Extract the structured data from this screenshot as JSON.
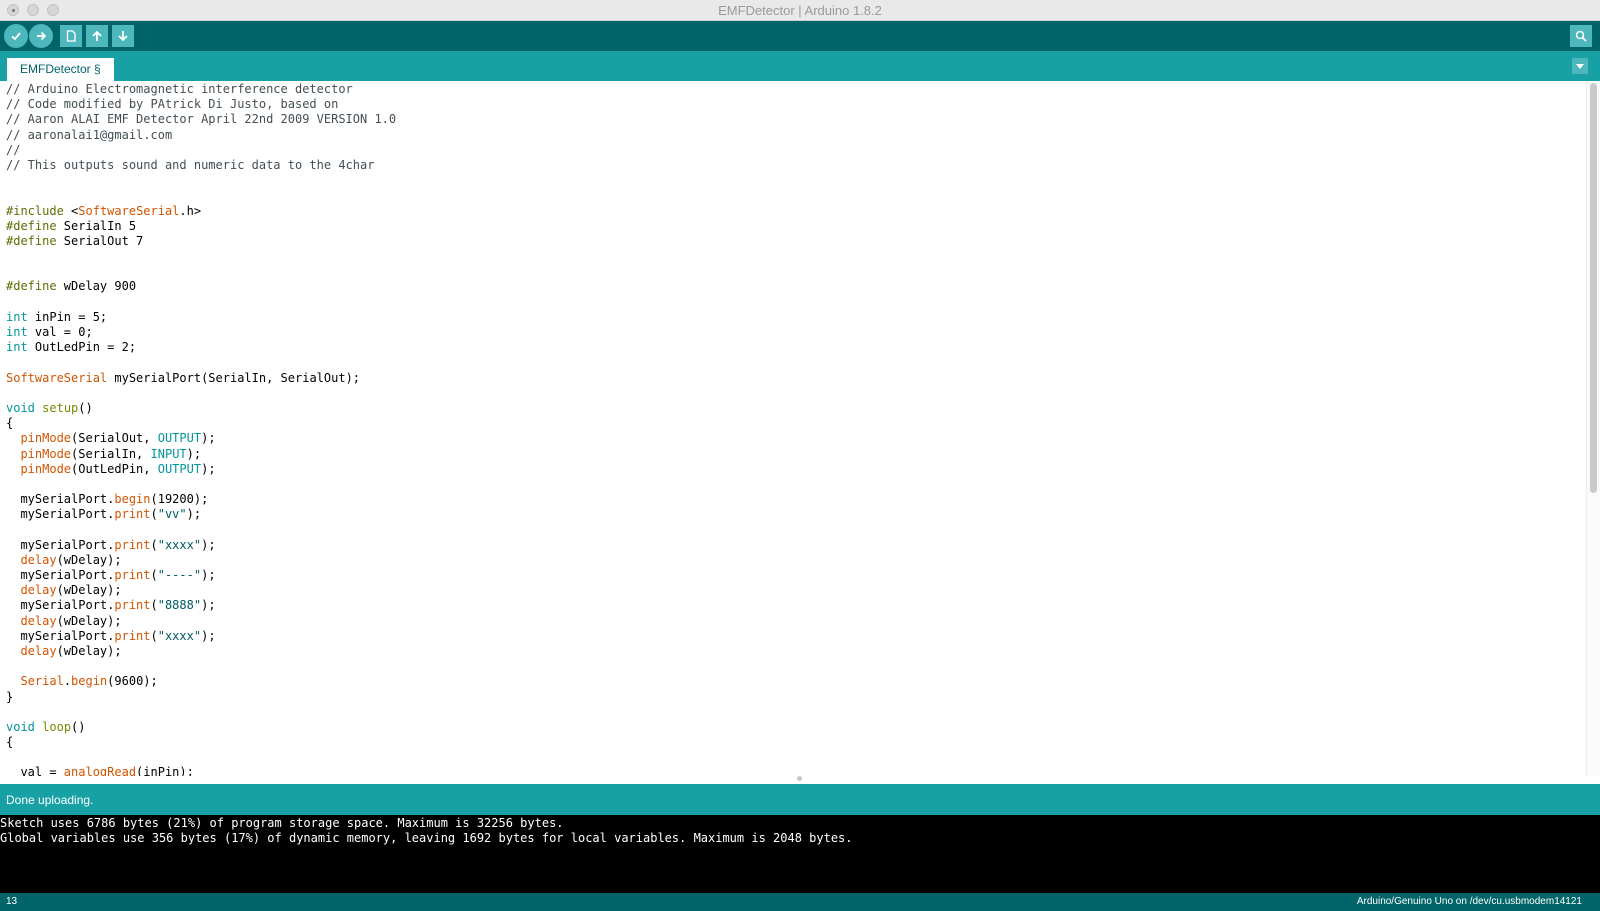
{
  "window": {
    "title": "EMFDetector | Arduino 1.8.2"
  },
  "toolbar": {
    "buttons": [
      {
        "name": "verify",
        "icon": "check-icon"
      },
      {
        "name": "upload",
        "icon": "arrow-right-icon"
      },
      {
        "name": "new",
        "icon": "document-icon"
      },
      {
        "name": "open",
        "icon": "arrow-up-icon"
      },
      {
        "name": "save",
        "icon": "arrow-down-icon"
      },
      {
        "name": "serial-monitor",
        "icon": "magnifier-icon"
      }
    ]
  },
  "tabs": [
    {
      "label": "EMFDetector §",
      "active": true
    }
  ],
  "editor": {
    "lines": [
      [
        [
          "c",
          "// Arduino Electromagnetic interference detector"
        ]
      ],
      [
        [
          "c",
          "// Code modified by PAtrick Di Justo, based on"
        ]
      ],
      [
        [
          "c",
          "// Aaron ALAI EMF Detector April 22nd 2009 VERSION 1.0"
        ]
      ],
      [
        [
          "c",
          "// aaronalai1@gmail.com"
        ]
      ],
      [
        [
          "c",
          "//"
        ]
      ],
      [
        [
          "c",
          "// This outputs sound and numeric data to the 4char"
        ]
      ],
      [],
      [],
      [
        [
          "p",
          "#include "
        ],
        [
          "n",
          "<"
        ],
        [
          "f",
          "SoftwareSerial"
        ],
        [
          "n",
          ".h>"
        ]
      ],
      [
        [
          "p",
          "#define"
        ],
        [
          "n",
          " SerialIn 5"
        ]
      ],
      [
        [
          "p",
          "#define"
        ],
        [
          "n",
          " SerialOut 7"
        ]
      ],
      [],
      [],
      [
        [
          "p",
          "#define"
        ],
        [
          "n",
          " wDelay 900"
        ]
      ],
      [],
      [
        [
          "t",
          "int"
        ],
        [
          "n",
          " inPin = 5;"
        ]
      ],
      [
        [
          "t",
          "int"
        ],
        [
          "n",
          " val = 0;"
        ]
      ],
      [
        [
          "t",
          "int"
        ],
        [
          "n",
          " OutLedPin = 2;"
        ]
      ],
      [],
      [
        [
          "f",
          "SoftwareSerial"
        ],
        [
          "n",
          " mySerialPort(SerialIn, SerialOut);"
        ]
      ],
      [],
      [
        [
          "t",
          "void"
        ],
        [
          "n",
          " "
        ],
        [
          "k",
          "setup"
        ],
        [
          "n",
          "()"
        ]
      ],
      [
        [
          "n",
          "{"
        ]
      ],
      [
        [
          "n",
          "  "
        ],
        [
          "f",
          "pinMode"
        ],
        [
          "n",
          "(SerialOut, "
        ],
        [
          "t",
          "OUTPUT"
        ],
        [
          "n",
          ");"
        ]
      ],
      [
        [
          "n",
          "  "
        ],
        [
          "f",
          "pinMode"
        ],
        [
          "n",
          "(SerialIn, "
        ],
        [
          "t",
          "INPUT"
        ],
        [
          "n",
          ");"
        ]
      ],
      [
        [
          "n",
          "  "
        ],
        [
          "f",
          "pinMode"
        ],
        [
          "n",
          "(OutLedPin, "
        ],
        [
          "t",
          "OUTPUT"
        ],
        [
          "n",
          ");"
        ]
      ],
      [],
      [
        [
          "n",
          "  mySerialPort."
        ],
        [
          "f",
          "begin"
        ],
        [
          "n",
          "(19200);"
        ]
      ],
      [
        [
          "n",
          "  mySerialPort."
        ],
        [
          "f",
          "print"
        ],
        [
          "n",
          "("
        ],
        [
          "s",
          "\"vv\""
        ],
        [
          "n",
          ");"
        ]
      ],
      [],
      [
        [
          "n",
          "  mySerialPort."
        ],
        [
          "f",
          "print"
        ],
        [
          "n",
          "("
        ],
        [
          "s",
          "\"xxxx\""
        ],
        [
          "n",
          ");"
        ]
      ],
      [
        [
          "n",
          "  "
        ],
        [
          "f",
          "delay"
        ],
        [
          "n",
          "(wDelay);"
        ]
      ],
      [
        [
          "n",
          "  mySerialPort."
        ],
        [
          "f",
          "print"
        ],
        [
          "n",
          "("
        ],
        [
          "s",
          "\"----\""
        ],
        [
          "n",
          ");"
        ]
      ],
      [
        [
          "n",
          "  "
        ],
        [
          "f",
          "delay"
        ],
        [
          "n",
          "(wDelay);"
        ]
      ],
      [
        [
          "n",
          "  mySerialPort."
        ],
        [
          "f",
          "print"
        ],
        [
          "n",
          "("
        ],
        [
          "s",
          "\"8888\""
        ],
        [
          "n",
          ");"
        ]
      ],
      [
        [
          "n",
          "  "
        ],
        [
          "f",
          "delay"
        ],
        [
          "n",
          "(wDelay);"
        ]
      ],
      [
        [
          "n",
          "  mySerialPort."
        ],
        [
          "f",
          "print"
        ],
        [
          "n",
          "("
        ],
        [
          "s",
          "\"xxxx\""
        ],
        [
          "n",
          ");"
        ]
      ],
      [
        [
          "n",
          "  "
        ],
        [
          "f",
          "delay"
        ],
        [
          "n",
          "(wDelay);"
        ]
      ],
      [],
      [
        [
          "n",
          "  "
        ],
        [
          "f",
          "Serial"
        ],
        [
          "n",
          "."
        ],
        [
          "f",
          "begin"
        ],
        [
          "n",
          "(9600);"
        ]
      ],
      [
        [
          "n",
          "}"
        ]
      ],
      [],
      [
        [
          "t",
          "void"
        ],
        [
          "n",
          " "
        ],
        [
          "k",
          "loop"
        ],
        [
          "n",
          "()"
        ]
      ],
      [
        [
          "n",
          "{"
        ]
      ],
      [],
      [
        [
          "n",
          "  val = "
        ],
        [
          "f",
          "analogRead"
        ],
        [
          "n",
          "(inPin);"
        ]
      ]
    ]
  },
  "status": {
    "message": "Done uploading."
  },
  "console": {
    "lines": [
      "Sketch uses 6786 bytes (21%) of program storage space. Maximum is 32256 bytes.",
      "Global variables use 356 bytes (17%) of dynamic memory, leaving 1692 bytes for local variables. Maximum is 2048 bytes."
    ]
  },
  "footer": {
    "line_number": "13",
    "board": "Arduino/Genuino Uno on /dev/cu.usbmodem14121"
  }
}
